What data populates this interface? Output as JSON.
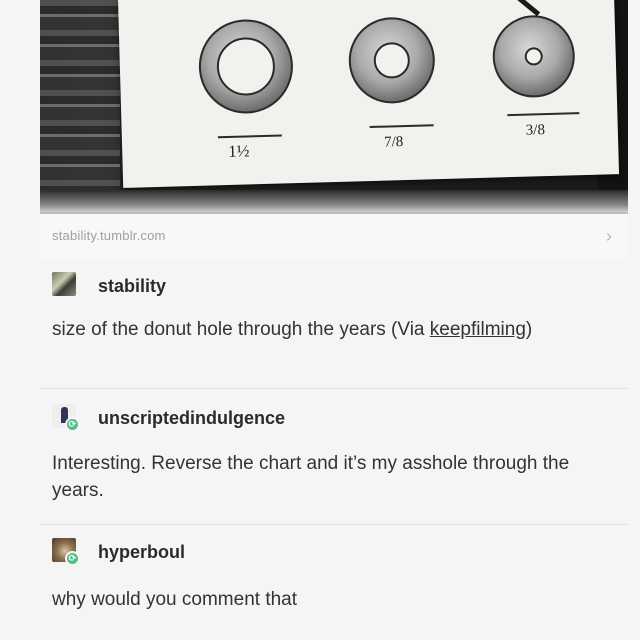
{
  "image": {
    "labels": [
      "1½",
      "7/8",
      "3/8"
    ]
  },
  "link_bar": {
    "url": "stability.tumblr.com",
    "chevron": "›"
  },
  "posts": [
    {
      "username": "stability",
      "avatar_icon": "photo-avatar-icon",
      "text_before": "size of the donut hole through the years (Via ",
      "link_text": "keepfilming",
      "text_after": ")"
    },
    {
      "username": "unscriptedindulgence",
      "avatar_icon": "figure-avatar-icon",
      "reblog_icon": "reblog-icon",
      "text": "Interesting. Reverse the chart and it’s my asshole through the years."
    },
    {
      "username": "hyperboul",
      "avatar_icon": "cat-avatar-icon",
      "reblog_icon": "reblog-icon",
      "text": "why would you comment that"
    }
  ],
  "colors": {
    "reblog_badge": "#56bc8a",
    "link_text": "#9aa0a6"
  }
}
